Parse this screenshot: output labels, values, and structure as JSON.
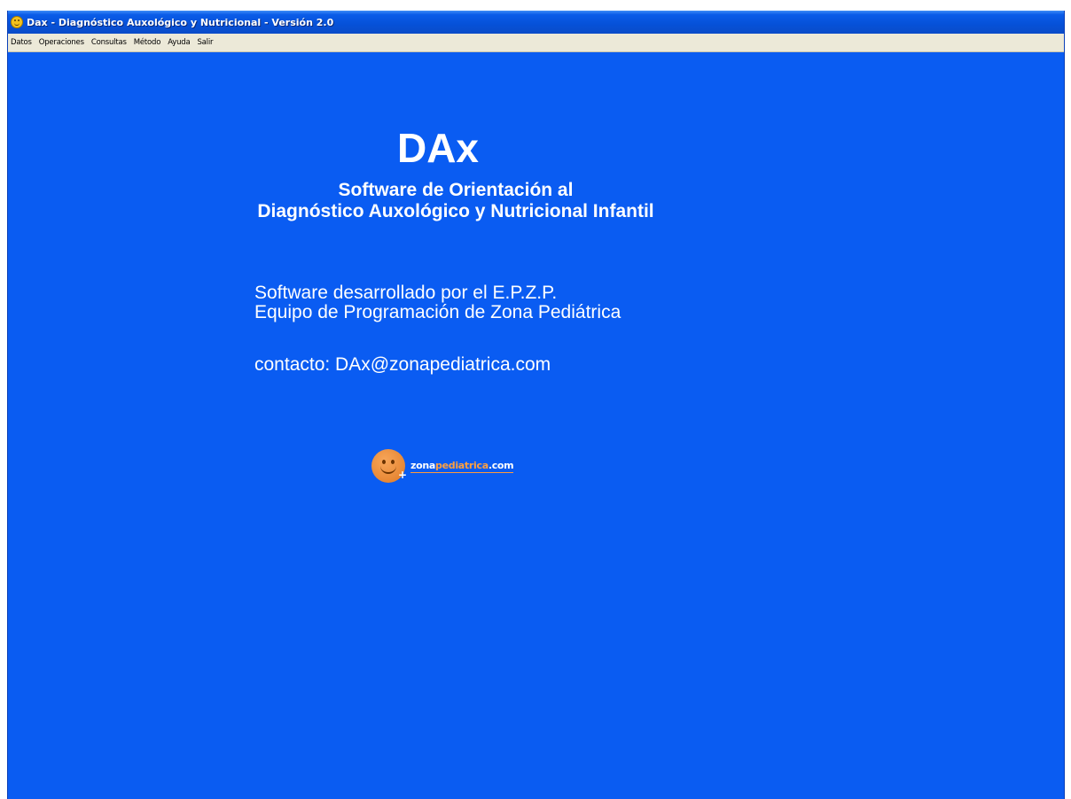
{
  "window": {
    "title": "Dax - Diagnóstico Auxológico y Nutricional - Versión 2.0",
    "icon": "smiley-app-icon",
    "background_color": "#0a5cf2"
  },
  "menu": {
    "items": [
      "Datos",
      "Operaciones",
      "Consultas",
      "Método",
      "Ayuda",
      "Salir"
    ]
  },
  "splash": {
    "title": "DAx",
    "subtitle_line1": "Software de Orientación al",
    "subtitle_line2": "Diagnóstico Auxológico y Nutricional Infantil",
    "developer_line1": "Software desarrollado por el E.P.Z.P.",
    "developer_line2": "Equipo de Programación de Zona Pediátrica",
    "contact": "contacto: DAx@zonapediatrica.com"
  },
  "logo": {
    "text_part1": "zona",
    "text_part2": "pediatrica",
    "text_part3": ".com",
    "accent_color": "#f08a30"
  }
}
